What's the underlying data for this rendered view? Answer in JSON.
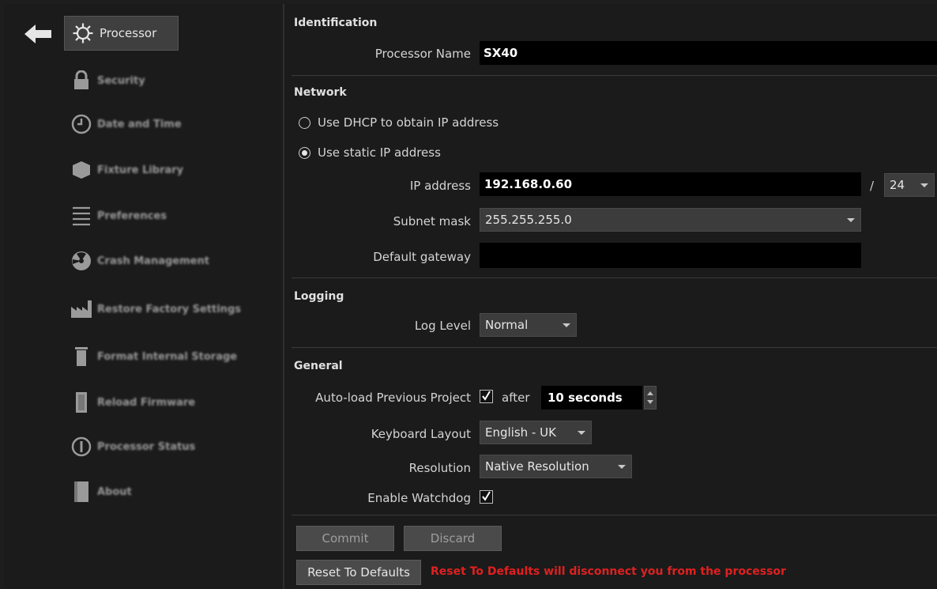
{
  "sidebar": {
    "active_label": "Processor",
    "items": [
      {
        "label": "Security",
        "icon": "lock-icon"
      },
      {
        "label": "Date and Time",
        "icon": "clock-icon"
      },
      {
        "label": "Fixture Library",
        "icon": "cube-icon"
      },
      {
        "label": "Preferences",
        "icon": "list-icon"
      },
      {
        "label": "Crash Management",
        "icon": "radiation-icon"
      },
      {
        "label": "Restore Factory Settings",
        "icon": "factory-icon"
      },
      {
        "label": "Format Internal Storage",
        "icon": "trash-icon"
      },
      {
        "label": "Reload Firmware",
        "icon": "chip-icon"
      },
      {
        "label": "Processor Status",
        "icon": "info-icon"
      },
      {
        "label": "About",
        "icon": "book-icon"
      }
    ]
  },
  "identification": {
    "title": "Identification",
    "processor_name_label": "Processor Name",
    "processor_name_value": "SX40"
  },
  "network": {
    "title": "Network",
    "dhcp_label": "Use DHCP to obtain IP address",
    "static_label": "Use static IP address",
    "selected": "static",
    "ip_label": "IP address",
    "ip_value": "192.168.0.60",
    "prefix_sep": "/",
    "prefix_value": "24",
    "subnet_label": "Subnet mask",
    "subnet_value": "255.255.255.0",
    "gateway_label": "Default gateway",
    "gateway_value": ""
  },
  "logging": {
    "title": "Logging",
    "level_label": "Log Level",
    "level_value": "Normal"
  },
  "general": {
    "title": "General",
    "autoload_label": "Auto-load Previous Project",
    "autoload_checked": true,
    "after_label": "after",
    "delay_value": "10 seconds",
    "keyboard_label": "Keyboard Layout",
    "keyboard_value": "English - UK",
    "resolution_label": "Resolution",
    "resolution_value": "Native Resolution",
    "watchdog_label": "Enable Watchdog",
    "watchdog_checked": true
  },
  "actions": {
    "commit_label": "Commit",
    "discard_label": "Discard",
    "reset_label": "Reset To Defaults",
    "reset_warning": "Reset To Defaults will disconnect you from the processor"
  },
  "colors": {
    "background": "#1b1b1b",
    "field": "#000000",
    "dropdown": "#3c3c3c",
    "warning": "#e02020",
    "active_item": "#3f3f3f"
  }
}
